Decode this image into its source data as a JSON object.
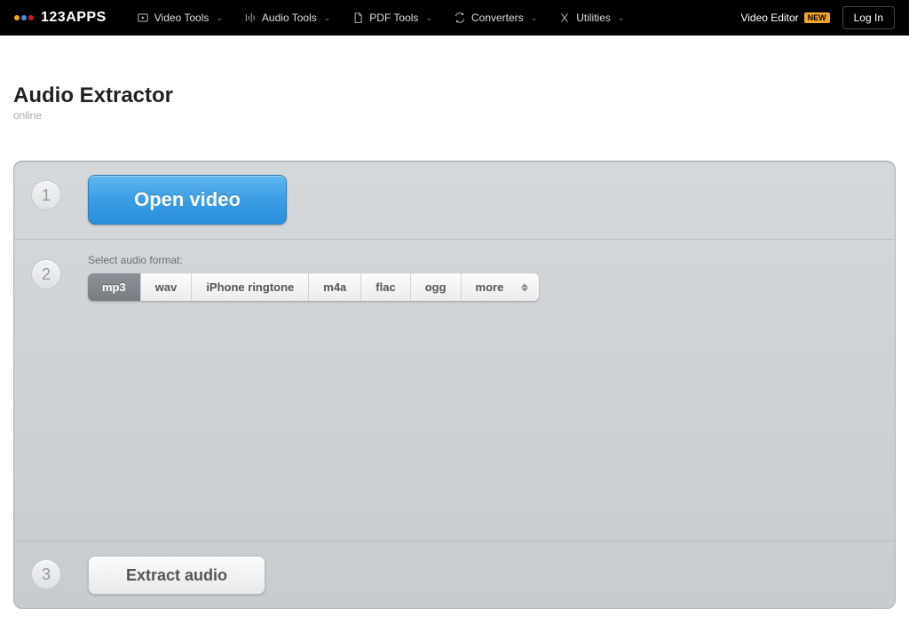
{
  "nav": {
    "brand": "123APPS",
    "items": [
      {
        "label": "Video Tools",
        "icon": "play"
      },
      {
        "label": "Audio Tools",
        "icon": "equalizer"
      },
      {
        "label": "PDF Tools",
        "icon": "pdf"
      },
      {
        "label": "Converters",
        "icon": "convert"
      },
      {
        "label": "Utilities",
        "icon": "utilities"
      }
    ],
    "video_editor_label": "Video Editor",
    "video_editor_badge": "NEW",
    "login_label": "Log In"
  },
  "page": {
    "title": "Audio Extractor",
    "subtitle": "online"
  },
  "steps": {
    "s1_num": "1",
    "s1_button": "Open video",
    "s2_num": "2",
    "s2_label": "Select audio format:",
    "formats": [
      "mp3",
      "wav",
      "iPhone ringtone",
      "m4a",
      "flac",
      "ogg",
      "more"
    ],
    "selected_format_index": 0,
    "s3_num": "3",
    "s3_button": "Extract audio"
  }
}
